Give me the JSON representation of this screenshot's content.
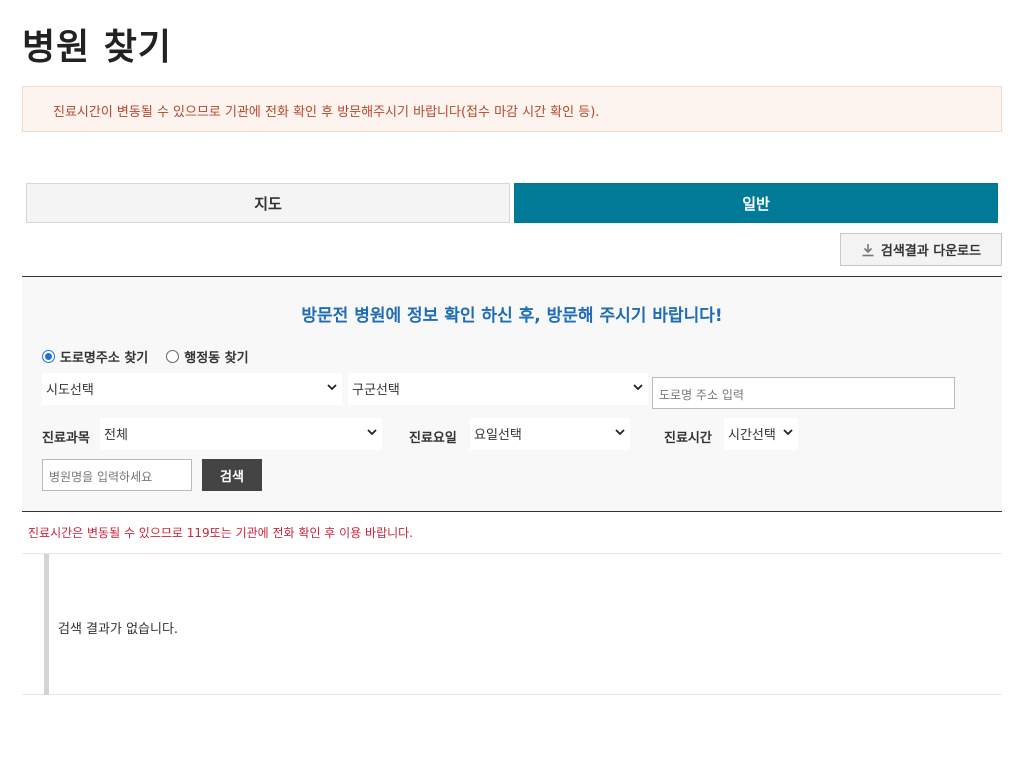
{
  "page": {
    "title": "병원 찾기"
  },
  "notice": {
    "text": "진료시간이 변동될 수 있으므로 기관에 전화 확인 후 방문해주시기 바랍니다(접수 마감 시간 확인 등)."
  },
  "tabs": [
    {
      "label": "지도",
      "active": false
    },
    {
      "label": "일반",
      "active": true
    }
  ],
  "download": {
    "label": "검색결과 다운로드",
    "icon": "download-icon"
  },
  "search": {
    "heading": "방문전 병원에 정보 확인 하신 후, 방문해 주시기 바랍니다!",
    "radio_road": "도로명주소 찾기",
    "radio_admin": "행정동 찾기",
    "selected_radio": "도로명주소 찾기",
    "sido_select": "시도선택",
    "gugun_select": "구군선택",
    "road_address_placeholder": "도로명 주소 입력",
    "dept_label": "진료과목",
    "dept_select": "전체",
    "day_label": "진료요일",
    "day_select": "요일선택",
    "time_label": "진료시간",
    "time_select": "시간선택",
    "hospital_name_placeholder": "병원명을 입력하세요",
    "search_button": "검색"
  },
  "warning": {
    "text": "진료시간은 변동될 수 있으므로 119또는 기관에 전화 확인 후 이용 바랍니다."
  },
  "results": {
    "empty_text": "검색 결과가 없습니다."
  },
  "colors": {
    "accent": "#007a96",
    "heading_blue": "#1e6db5",
    "warning_red": "#c8263c",
    "notice_text": "#b5482b"
  }
}
